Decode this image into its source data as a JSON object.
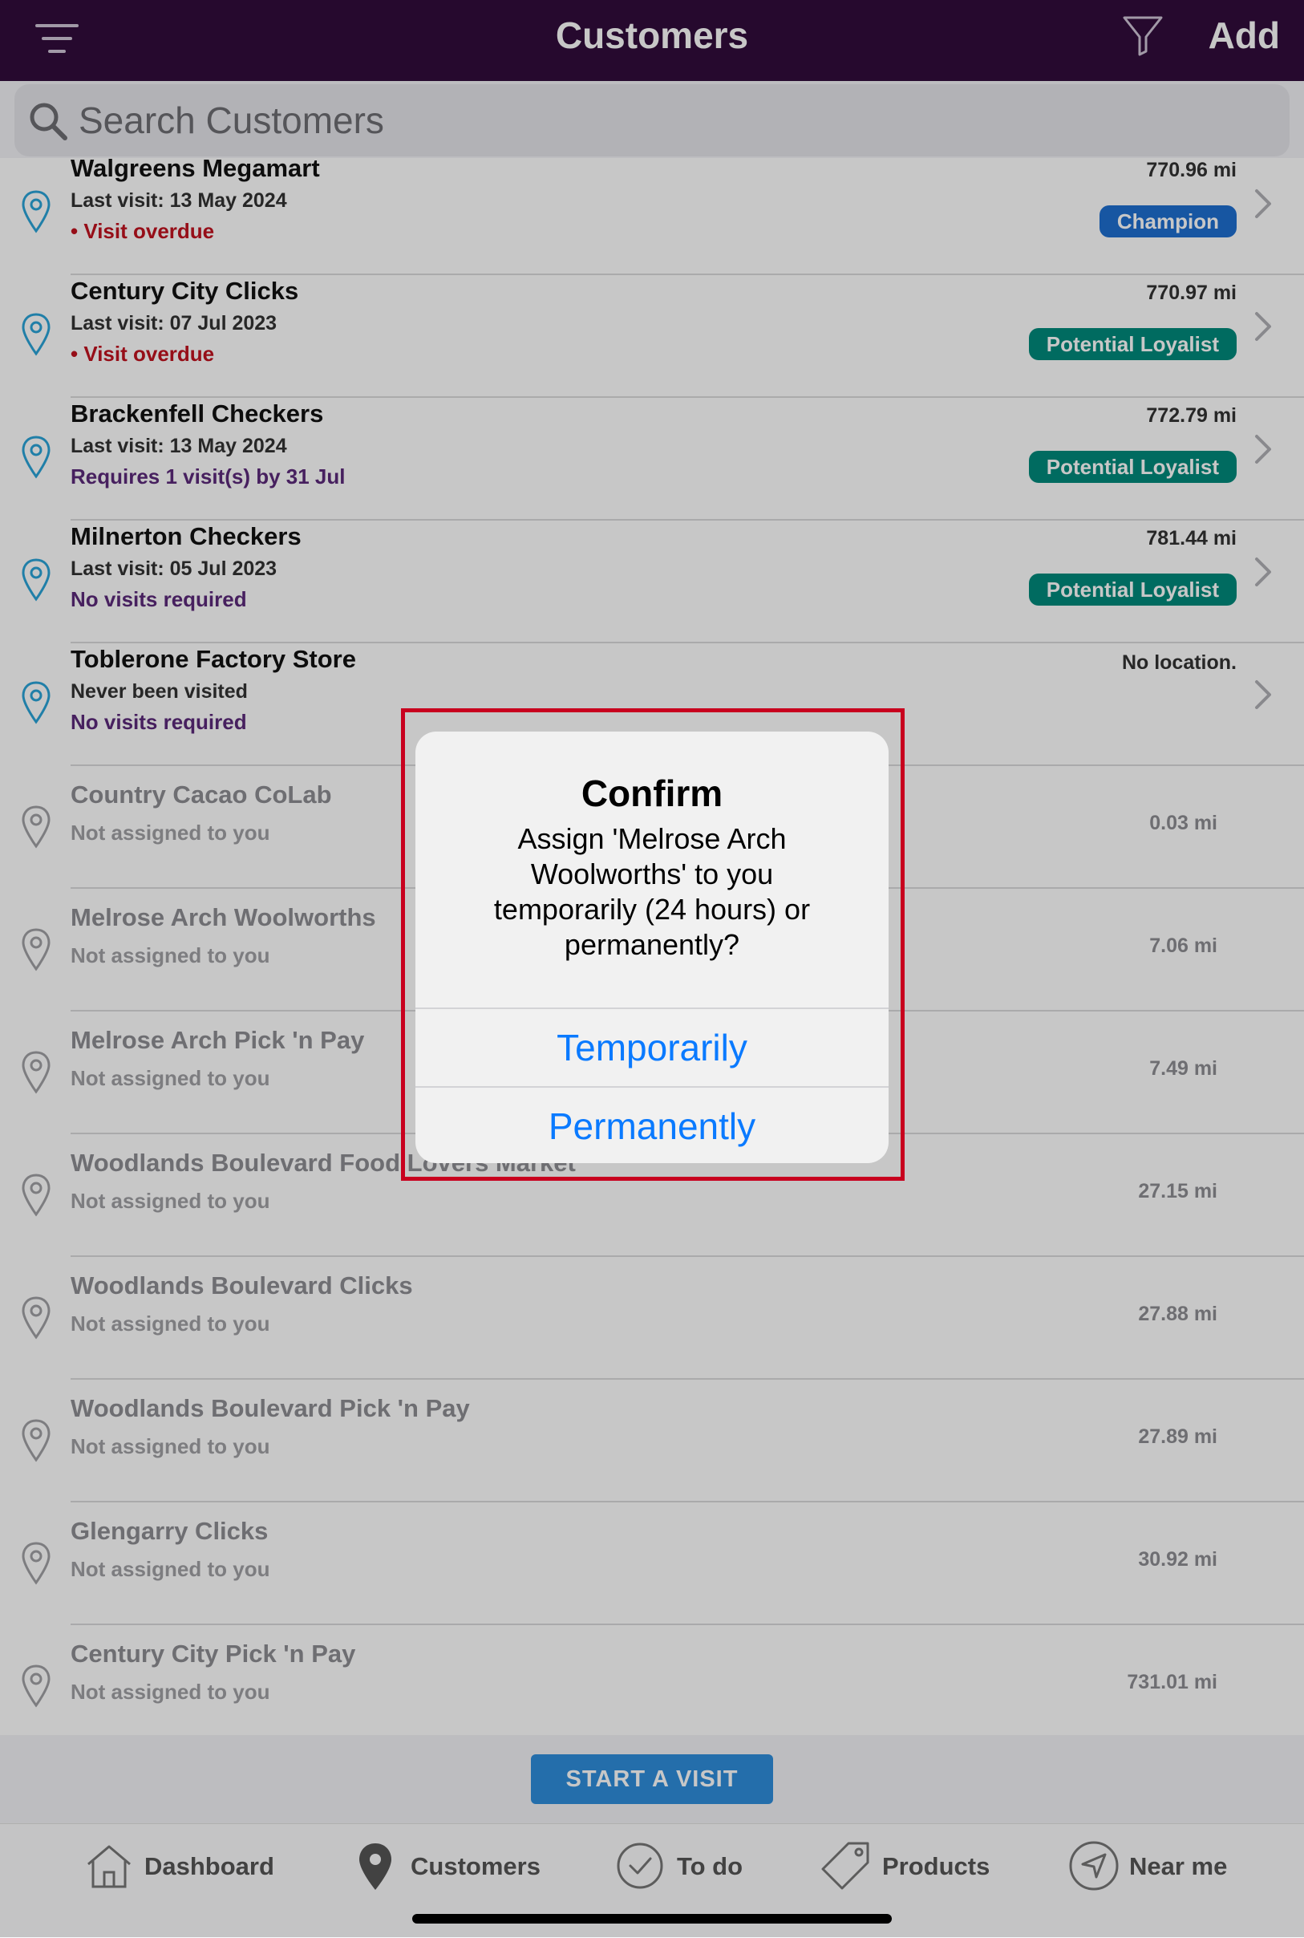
{
  "header": {
    "title": "Customers",
    "add_label": "Add",
    "icons": {
      "menu": "menu-lines-icon",
      "filter": "filter-icon"
    }
  },
  "search": {
    "placeholder": "Search Customers",
    "icon": "search-icon"
  },
  "customers": [
    {
      "name": "Walgreens Megamart",
      "last_visit": "Last visit: 13 May 2024",
      "status": "• Visit overdue",
      "status_type": "overdue",
      "distance": "770.96 mi",
      "badge": "Champion",
      "badge_type": "champion"
    },
    {
      "name": "Century City Clicks",
      "last_visit": "Last visit: 07 Jul 2023",
      "status": "• Visit overdue",
      "status_type": "overdue",
      "distance": "770.97 mi",
      "badge": "Potential Loyalist",
      "badge_type": "loyalist"
    },
    {
      "name": "Brackenfell Checkers",
      "last_visit": "Last visit: 13 May 2024",
      "status": "Requires 1 visit(s) by 31 Jul",
      "status_type": "purple",
      "distance": "772.79 mi",
      "badge": "Potential Loyalist",
      "badge_type": "loyalist"
    },
    {
      "name": "Milnerton Checkers",
      "last_visit": "Last visit: 05 Jul 2023",
      "status": "No visits required",
      "status_type": "purple",
      "distance": "781.44 mi",
      "badge": "Potential Loyalist",
      "badge_type": "loyalist"
    },
    {
      "name": "Toblerone Factory Store",
      "last_visit": "Never been visited",
      "status": "No visits required",
      "status_type": "purple",
      "distance": "No location.",
      "badge": "",
      "badge_type": ""
    }
  ],
  "unassigned": [
    {
      "name": "Country Cacao CoLab",
      "note": "Not assigned to you",
      "distance": "0.03 mi"
    },
    {
      "name": "Melrose Arch Woolworths",
      "note": "Not assigned to you",
      "distance": "7.06 mi"
    },
    {
      "name": "Melrose Arch Pick 'n Pay",
      "note": "Not assigned to you",
      "distance": "7.49 mi"
    },
    {
      "name": "Woodlands Boulevard Food Lovers Market",
      "note": "Not assigned to you",
      "distance": "27.15 mi"
    },
    {
      "name": "Woodlands Boulevard Clicks",
      "note": "Not assigned to you",
      "distance": "27.88 mi"
    },
    {
      "name": "Woodlands Boulevard Pick 'n Pay",
      "note": "Not assigned to you",
      "distance": "27.89 mi"
    },
    {
      "name": "Glengarry Clicks",
      "note": "Not assigned to you",
      "distance": "30.92 mi"
    },
    {
      "name": "Century City Pick 'n Pay",
      "note": "Not assigned to you",
      "distance": "731.01 mi"
    }
  ],
  "start_visit_label": "START A VISIT",
  "tabs": [
    {
      "label": "Dashboard",
      "icon": "home-icon"
    },
    {
      "label": "Customers",
      "icon": "location-pin-icon"
    },
    {
      "label": "To do",
      "icon": "checkmark-circle-icon"
    },
    {
      "label": "Products",
      "icon": "tag-icon"
    },
    {
      "label": "Near me",
      "icon": "navigation-arrow-icon"
    }
  ],
  "dialog": {
    "title": "Confirm",
    "message": "Assign 'Melrose Arch Woolworths' to you temporarily (24 hours) or permanently?",
    "temporarily_label": "Temporarily",
    "permanently_label": "Permanently"
  },
  "colors": {
    "header_bg": "#310c3c",
    "overdue": "#c1121f",
    "purple_status": "#5b2a7a",
    "champion_badge": "#1e6fd0",
    "loyalist_badge": "#00897b",
    "start_button": "#2f8ddc",
    "dialog_button": "#0a7aff",
    "highlight_border": "#c8001e"
  }
}
